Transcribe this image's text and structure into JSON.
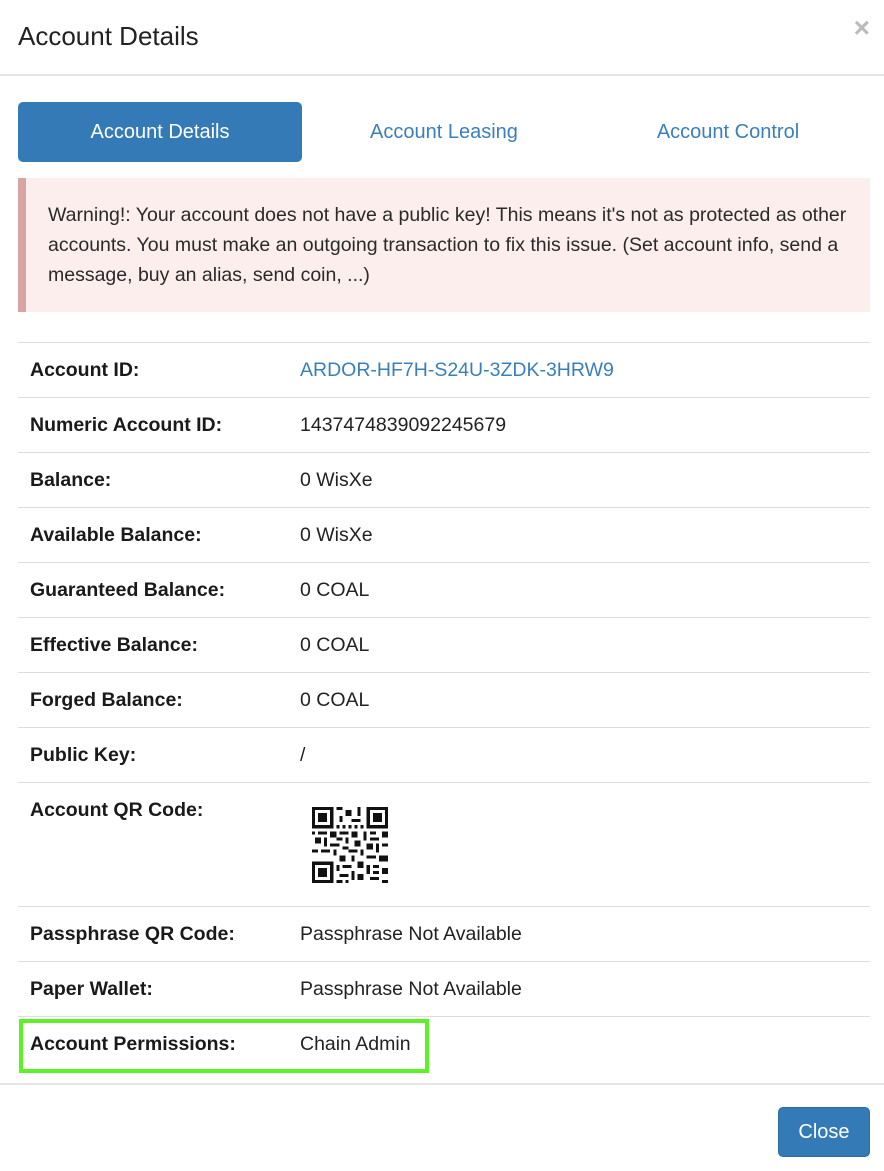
{
  "modal": {
    "title": "Account Details",
    "close_symbol": "×"
  },
  "tabs": [
    {
      "label": "Account Details",
      "active": true
    },
    {
      "label": "Account Leasing",
      "active": false
    },
    {
      "label": "Account Control",
      "active": false
    }
  ],
  "alert": {
    "text": "Warning!: Your account does not have a public key! This means it's not as protected as other accounts. You must make an outgoing transaction to fix this issue. (Set account info, send a message, buy an alias, send coin, ...)"
  },
  "details": [
    {
      "label": "Account ID:",
      "value": "ARDOR-HF7H-S24U-3ZDK-3HRW9"
    },
    {
      "label": "Numeric Account ID:",
      "value": "1437474839092245679"
    },
    {
      "label": "Balance:",
      "value": "0 WisXe"
    },
    {
      "label": "Available Balance:",
      "value": "0 WisXe"
    },
    {
      "label": "Guaranteed Balance:",
      "value": "0 COAL"
    },
    {
      "label": "Effective Balance:",
      "value": "0 COAL"
    },
    {
      "label": "Forged Balance:",
      "value": "0 COAL"
    },
    {
      "label": "Public Key:",
      "value": "/"
    },
    {
      "label": "Account QR Code:",
      "value": ""
    },
    {
      "label": "Passphrase QR Code:",
      "value": "Passphrase Not Available"
    },
    {
      "label": "Paper Wallet:",
      "value": "Passphrase Not Available"
    },
    {
      "label": "Account Permissions:",
      "value": "Chain Admin"
    }
  ],
  "footer": {
    "close_label": "Close"
  },
  "colors": {
    "primary": "#337ab7",
    "link": "#3a7fbd",
    "alert_bg": "#fbeeed",
    "alert_border": "#d8a4a4",
    "highlight": "#5cf227"
  }
}
